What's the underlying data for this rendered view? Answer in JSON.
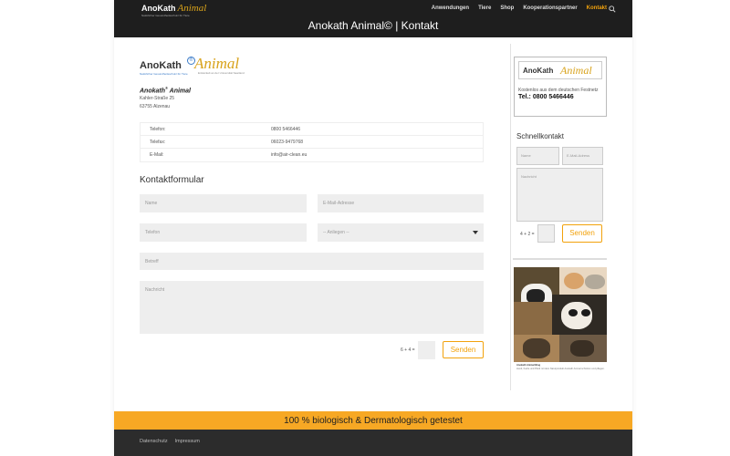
{
  "header": {
    "logo_text_ano": "AnoKath",
    "logo_text_animal": "Animal",
    "logo_tagline": "Natürlicher Gesundheitsschutz für Tiere",
    "nav": [
      "Anwendungen",
      "Tiere",
      "Shop",
      "Kooperationspartner",
      "Kontakt"
    ],
    "active_nav": "Kontakt",
    "page_title": "Anokath Animal© | Kontakt"
  },
  "company": {
    "logo_ano": "AnoKath",
    "logo_animal": "Animal",
    "logo_sub_left": "Natürlicher Gesundheitsschutz für Tiere",
    "logo_sub_right": "Entwickelt an der Universität Saarland",
    "brand_name": "Anokath",
    "brand_suffix": "Animal",
    "street": "Kahler-Straße 25",
    "city": "63755 Alzenau"
  },
  "contact_table": [
    {
      "label": "Telefon:",
      "value": "0800 5466446"
    },
    {
      "label": "Telefax:",
      "value": "06023-9479768"
    },
    {
      "label": "E-Mail:",
      "value": "info@air-clean.eu"
    }
  ],
  "form": {
    "title": "Kontaktformular",
    "name_placeholder": "Name",
    "email_placeholder": "E-Mail-Adresse",
    "phone_placeholder": "Telefon",
    "select_value": "-- Anliegen --",
    "subject_placeholder": "Betreff",
    "message_placeholder": "Nachricht",
    "captcha": "6 + 4 =",
    "submit_label": "Senden"
  },
  "sidebar": {
    "card_logo_ano": "AnoKath",
    "card_logo_animal": "Animal",
    "card_note": "Kostenlos aus dem deutschen Festnetz",
    "card_tel": "Tel.: 0800 5466446",
    "quick_title": "Schnellkontakt",
    "name_placeholder": "Name",
    "email_placeholder": "E-Mail-Adress",
    "message_placeholder": "Nachricht",
    "captcha": "4 + 2 =",
    "submit_label": "Senden",
    "photo_caption_title": "Anokath Animal Blog",
    "photo_caption_body": "Hund, Katze und Pferd mit dem Naturprodukt Anokath Animal schützen und pflegen."
  },
  "footer": {
    "banner": "100 % biologisch & Dermatologisch getestet",
    "links": [
      "Datenschutz",
      "Impressum"
    ]
  },
  "colors": {
    "accent": "#f2a20c",
    "banner": "#f7a824",
    "dark": "#1e1e1e"
  }
}
